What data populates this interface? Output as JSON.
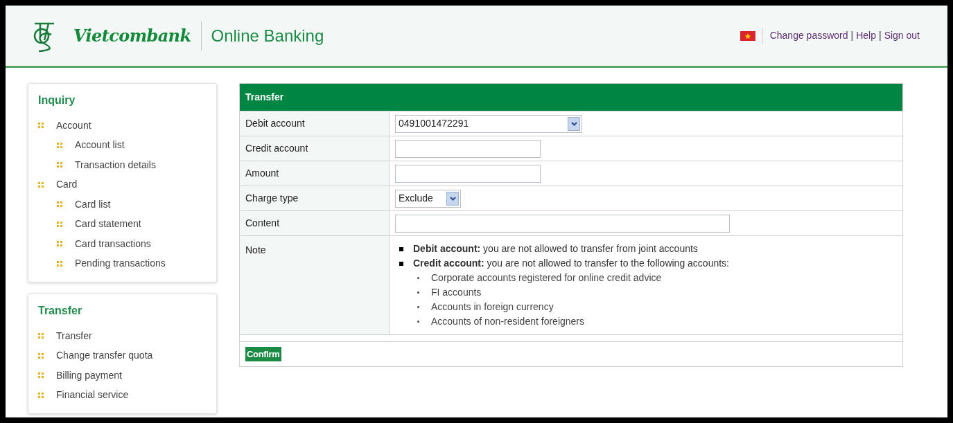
{
  "header": {
    "brand": "Vietcombank",
    "product": "Online Banking",
    "nav": [
      {
        "kind": "link",
        "text": "Change password"
      },
      {
        "kind": "separator",
        "text": "|"
      },
      {
        "kind": "link",
        "text": "Help"
      },
      {
        "kind": "separator",
        "text": "|"
      },
      {
        "kind": "link",
        "text": "Sign out"
      }
    ]
  },
  "sidebar": [
    {
      "title": "Inquiry",
      "items": [
        {
          "label": "Account",
          "children": [
            {
              "label": "Account list"
            },
            {
              "label": "Transaction details"
            }
          ]
        },
        {
          "label": "Card",
          "children": [
            {
              "label": "Card list"
            },
            {
              "label": "Card statement"
            },
            {
              "label": "Card transactions"
            },
            {
              "label": "Pending transactions"
            }
          ]
        }
      ]
    },
    {
      "title": "Transfer",
      "items": [
        {
          "label": "Transfer"
        },
        {
          "label": "Change transfer quota"
        },
        {
          "label": "Billing payment"
        },
        {
          "label": "Financial service"
        }
      ]
    }
  ],
  "form": {
    "title": "Transfer",
    "rows": [
      {
        "kind": "select",
        "label": "Debit account",
        "value": "0491001472291"
      },
      {
        "kind": "input",
        "label": "Credit account"
      },
      {
        "kind": "input",
        "label": "Amount"
      },
      {
        "kind": "select",
        "label": "Charge type",
        "value": "Exclude"
      },
      {
        "kind": "input",
        "label": "Content"
      },
      {
        "kind": "note",
        "label": "Note",
        "items": [
          {
            "text": "**Debit account:** you are not allowed to transfer from joint accounts"
          },
          {
            "text": "**Credit account:** you are not allowed to transfer to the following accounts:",
            "children": [
              {
                "text": "Corporate accounts registered for online credit advice"
              },
              {
                "text": "FI accounts"
              },
              {
                "text": "Accounts in foreign currency"
              },
              {
                "text": "Accounts of non-resident foreigners"
              }
            ]
          }
        ]
      }
    ],
    "button": "Confirm"
  }
}
